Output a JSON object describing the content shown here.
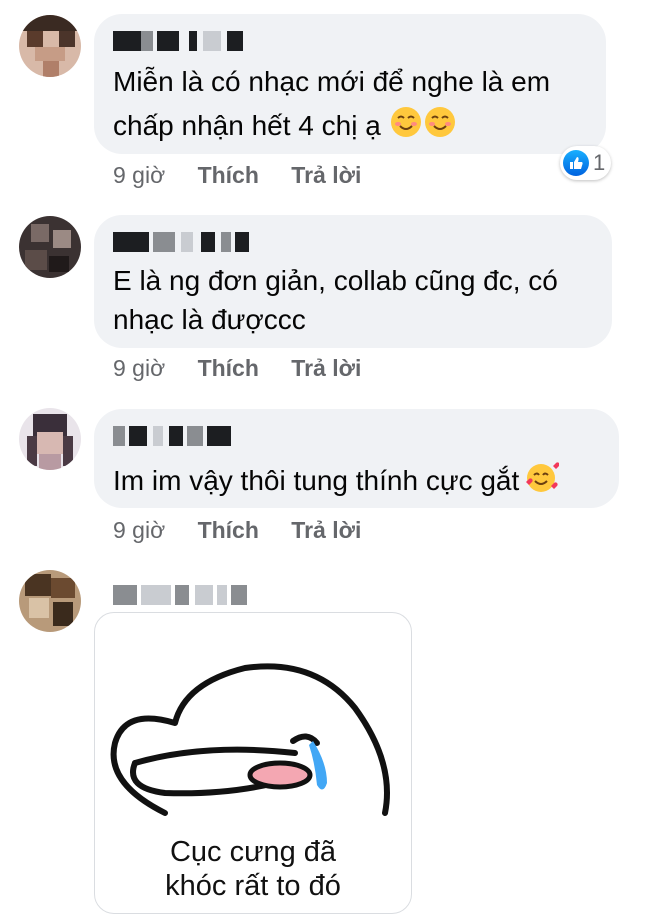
{
  "comments": [
    {
      "text_line1": "Miễn là có nhạc mới để nghe là em",
      "text_line2": "chấp nhận hết 4 chị ạ",
      "emoji": "smiling-face-emoji",
      "time": "9 giờ",
      "like": "Thích",
      "reply": "Trả lời",
      "reaction_count": "1"
    },
    {
      "text_line1": "E là ng đơn giản, collab cũng đc, có",
      "text_line2": "nhạc là đượccc",
      "time": "9 giờ",
      "like": "Thích",
      "reply": "Trả lời"
    },
    {
      "text_line1": "Im im vậy thôi tung thính cực gắt",
      "emoji": "smiling-face-with-hearts-emoji",
      "time": "9 giờ",
      "like": "Thích",
      "reply": "Trả lời"
    },
    {
      "sticker": {
        "caption_line1": "Cục cưng đã",
        "caption_line2": "khóc rất to đó"
      }
    }
  ],
  "colors": {
    "bubble": "#f0f2f5",
    "meta_text": "#65676b",
    "like_blue": "#1877f2"
  }
}
